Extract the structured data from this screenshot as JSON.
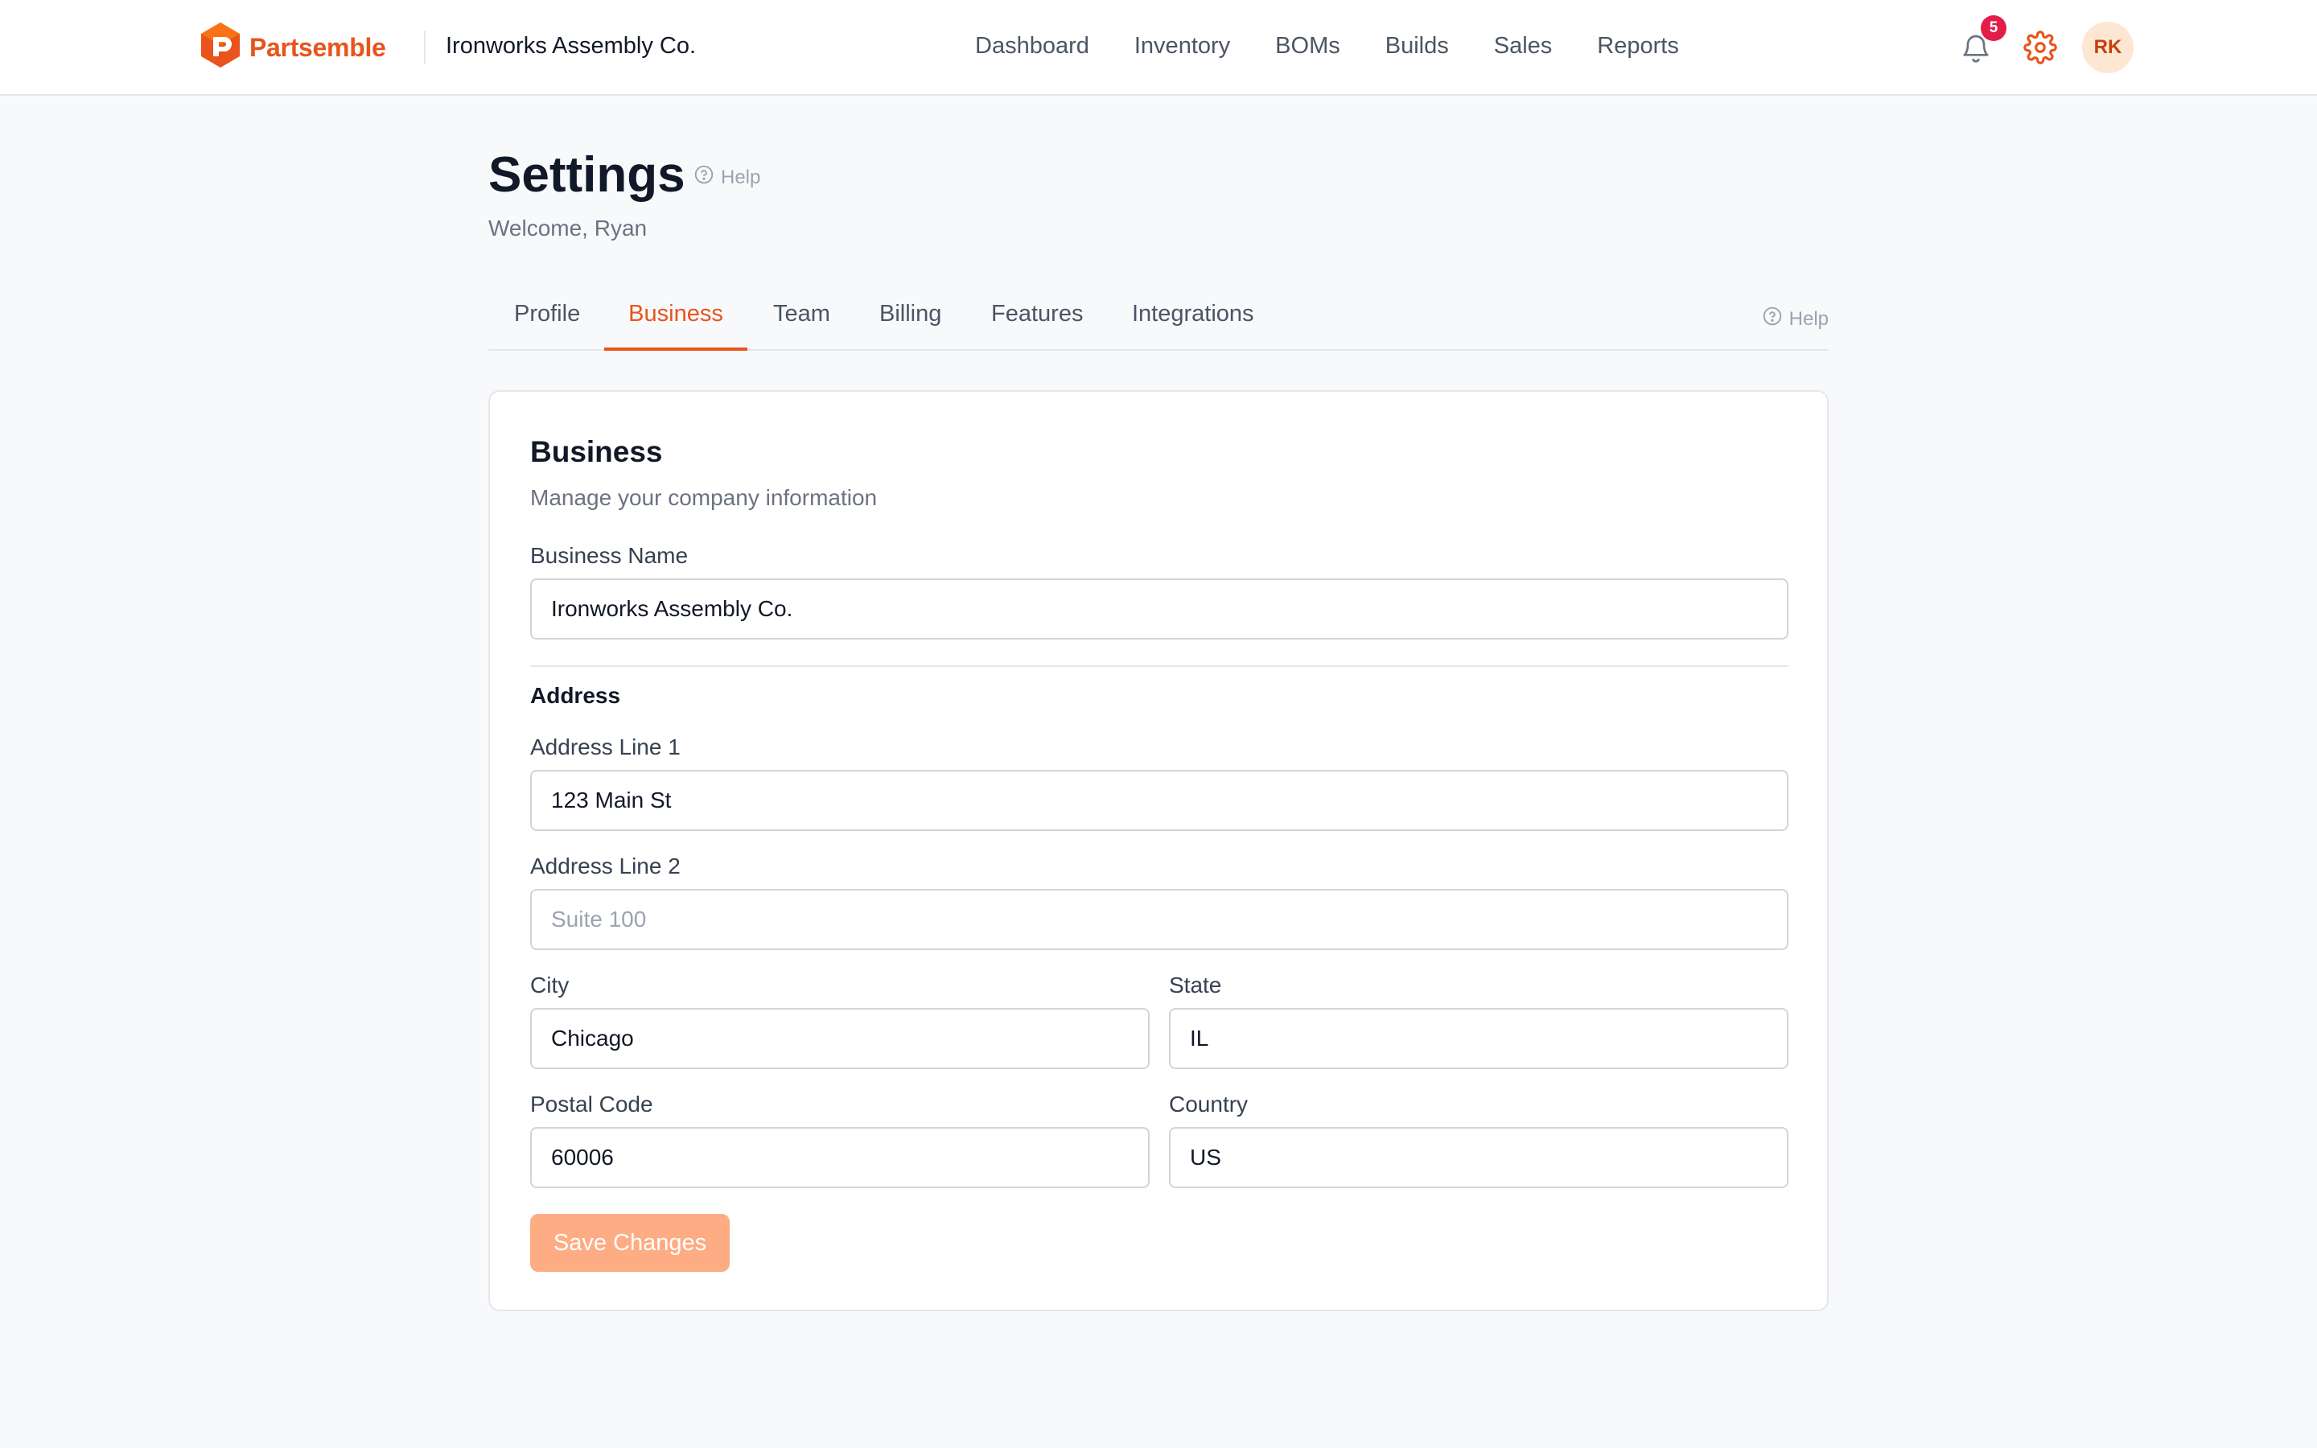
{
  "brand": {
    "name": "Partsemble",
    "accent": "#e8541c"
  },
  "org": {
    "name": "Ironworks Assembly Co."
  },
  "nav": {
    "items": [
      "Dashboard",
      "Inventory",
      "BOMs",
      "Builds",
      "Sales",
      "Reports"
    ]
  },
  "header_icons": {
    "notifications": {
      "icon": "bell-icon",
      "badge": "5"
    },
    "settings": {
      "icon": "gear-icon"
    },
    "avatar": {
      "initials": "RK"
    }
  },
  "page": {
    "title": "Settings",
    "help": "Help",
    "welcome": "Welcome, Ryan"
  },
  "tabs": {
    "items": [
      "Profile",
      "Business",
      "Team",
      "Billing",
      "Features",
      "Integrations"
    ],
    "active": "Business",
    "help": "Help"
  },
  "card": {
    "title": "Business",
    "subtitle": "Manage your company information",
    "business_name": {
      "label": "Business Name",
      "value": "Ironworks Assembly Co."
    },
    "address_heading": "Address",
    "address_line1": {
      "label": "Address Line 1",
      "value": "123 Main St"
    },
    "address_line2": {
      "label": "Address Line 2",
      "value": "",
      "placeholder": "Suite 100"
    },
    "city": {
      "label": "City",
      "value": "Chicago"
    },
    "state": {
      "label": "State",
      "value": "IL"
    },
    "postal_code": {
      "label": "Postal Code",
      "value": "60006"
    },
    "country": {
      "label": "Country",
      "value": "US"
    },
    "save_label": "Save Changes"
  }
}
